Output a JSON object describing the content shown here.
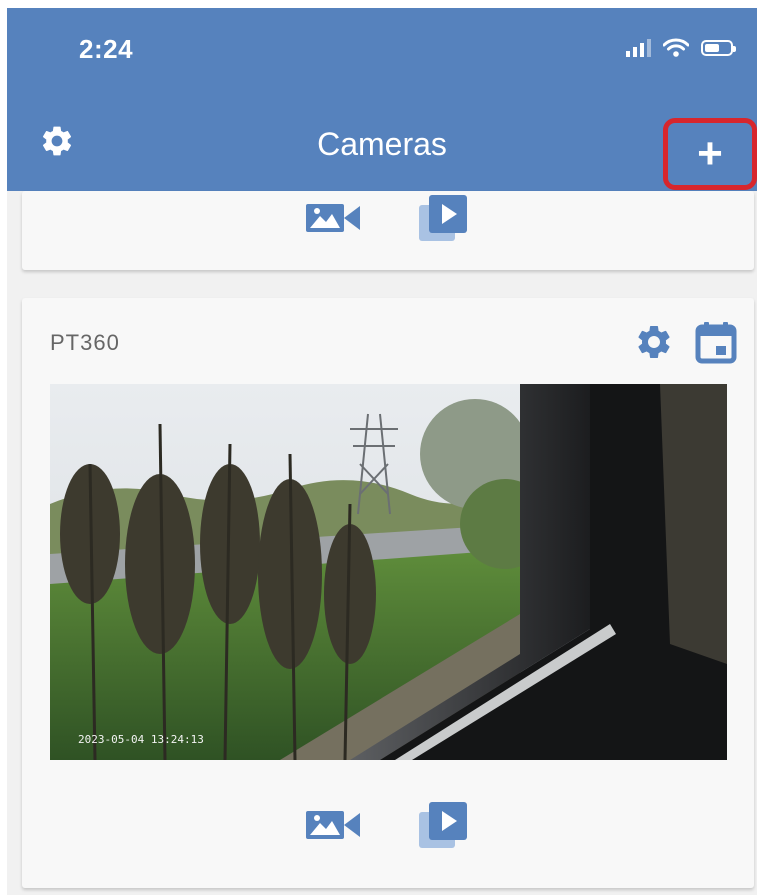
{
  "status_bar": {
    "time": "2:24"
  },
  "header": {
    "title": "Cameras"
  },
  "camera": {
    "name": "PT360",
    "timestamp": "2023-05-04 13:24:13"
  },
  "icons": {
    "settings": "gear-icon",
    "add": "plus-icon",
    "live": "video-camera-icon",
    "playback": "playback-icon",
    "calendar": "calendar-icon"
  },
  "colors": {
    "header": "#5682bd",
    "highlight": "#d7262d",
    "icon": "#5682bd"
  }
}
